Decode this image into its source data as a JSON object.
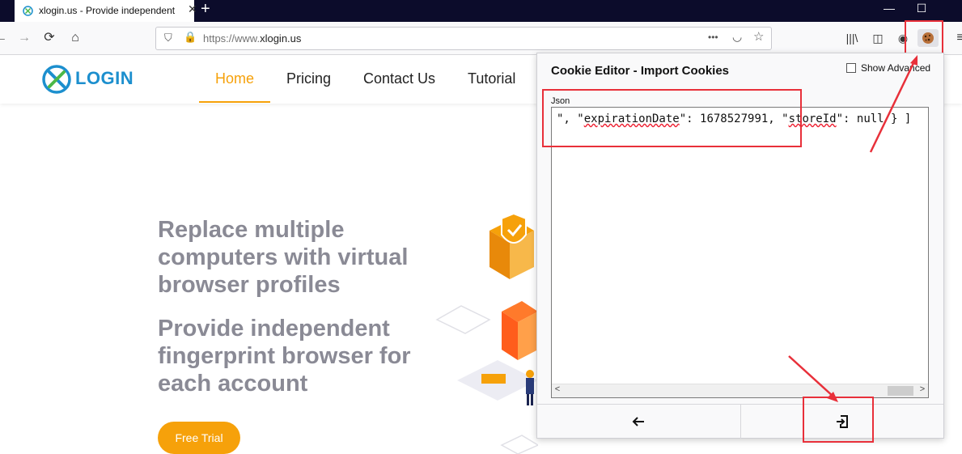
{
  "browser": {
    "tab_title": "xlogin.us - Provide independent",
    "tab_close_icon": "close-icon",
    "url_prefix": "https://www.",
    "url_domain": "xlogin.us",
    "more_icon": "•••"
  },
  "site": {
    "logo": "LOGIN",
    "nav": [
      "Home",
      "Pricing",
      "Contact Us",
      "Tutorial"
    ],
    "hero_lines": [
      "Replace multiple",
      "computers with virtual",
      "browser profiles",
      "Provide independent",
      "fingerprint browser for",
      "each account"
    ],
    "cta": "Free Trial"
  },
  "popup": {
    "title": "Cookie Editor - Import Cookies",
    "show_advanced": "Show Advanced",
    "show_advanced_checked": false,
    "json_label": "Json",
    "json_value_parts": [
      "\", \"",
      "expirationDate",
      "\": 1678527991, \"",
      "storeId",
      "\": null } ]"
    ],
    "back_icon": "back-arrow-icon",
    "import_icon": "import-icon"
  },
  "colors": {
    "accent": "#f6a10a",
    "brand": "#1c8fce",
    "highlight": "#e8303a"
  }
}
